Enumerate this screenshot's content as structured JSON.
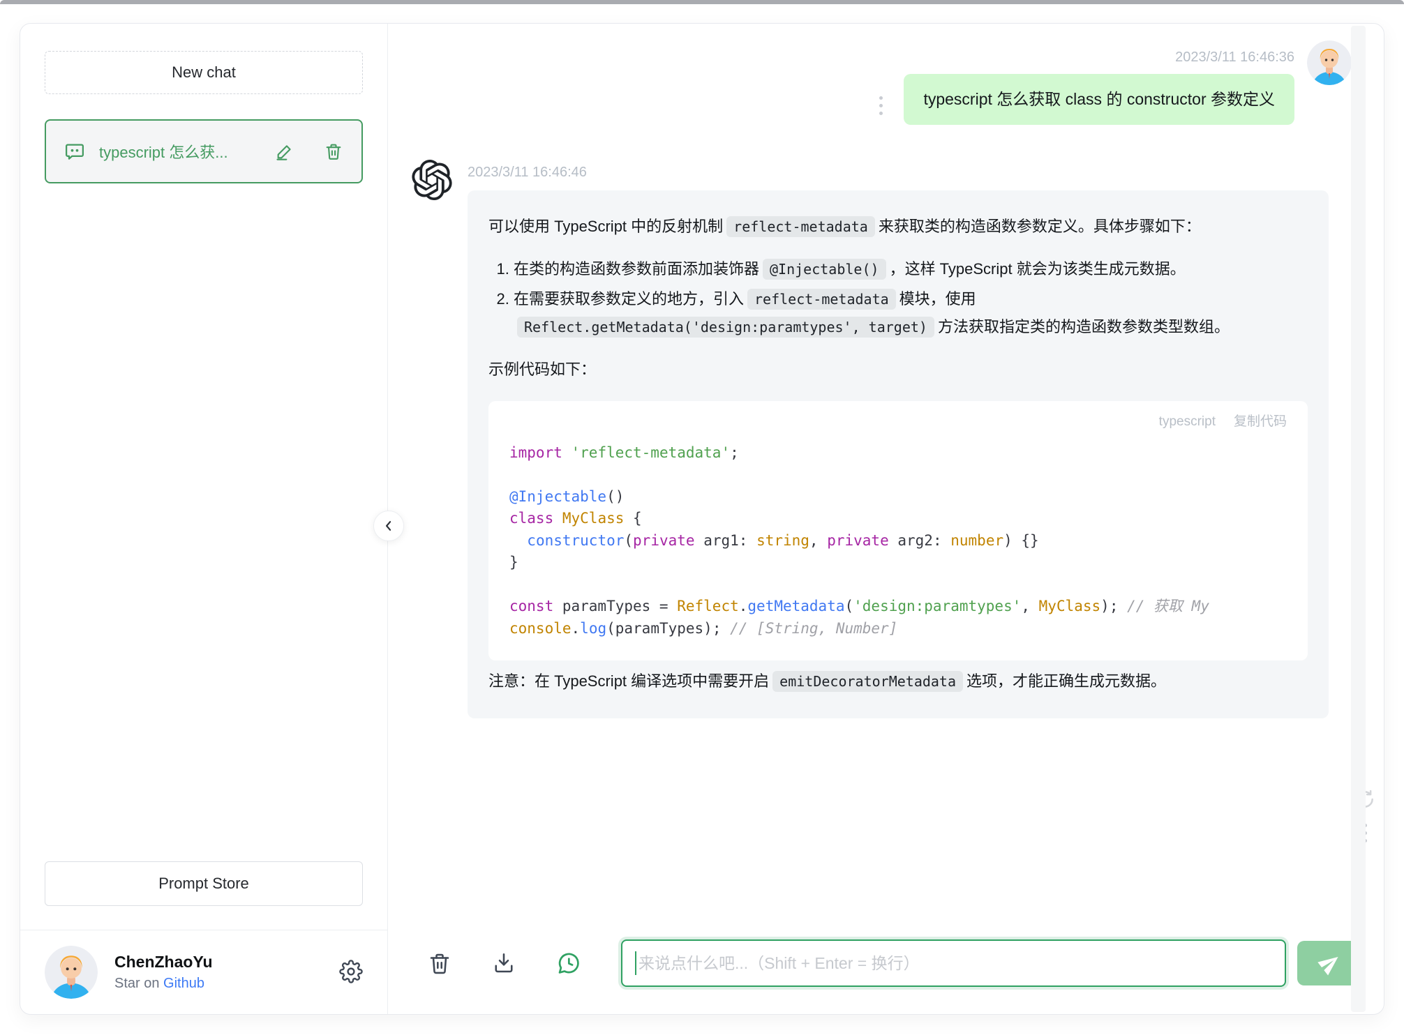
{
  "sidebar": {
    "new_chat_label": "New chat",
    "chat_item": {
      "title": "typescript 怎么获..."
    },
    "prompt_store_label": "Prompt Store",
    "user": {
      "name": "ChenZhaoYu",
      "star_prefix": "Star on ",
      "star_link": "Github"
    }
  },
  "chat": {
    "user_message": {
      "timestamp": "2023/3/11 16:46:36",
      "text": "typescript 怎么获取 class 的 constructor 参数定义"
    },
    "assistant_message": {
      "timestamp": "2023/3/11 16:46:46",
      "intro": [
        {
          "text": "可以使用 TypeScript 中的反射机制"
        },
        {
          "text": "reflect-metadata",
          "code": true
        },
        {
          "text": "来获取类的构造函数参数定义。具体步骤如下："
        }
      ],
      "steps": [
        [
          {
            "text": "在类的构造函数参数前面添加装饰器"
          },
          {
            "text": "@Injectable()",
            "code": true
          },
          {
            "text": "，这样 TypeScript 就会为该类生成元数据。"
          }
        ],
        [
          {
            "text": "在需要获取参数定义的地方，引入"
          },
          {
            "text": "reflect-metadata",
            "code": true
          },
          {
            "text": "模块，使用"
          },
          {
            "text": "Reflect.getMetadata('design:paramtypes', target)",
            "code": true
          },
          {
            "text": "方法获取指定类的构造函数参数类型数组。"
          }
        ]
      ],
      "example_label": "示例代码如下：",
      "code_block": {
        "language": "typescript",
        "copy_label": "复制代码",
        "lines": [
          [
            {
              "c": "kw",
              "t": "import"
            },
            {
              "c": "pl",
              "t": " "
            },
            {
              "c": "str",
              "t": "'reflect-metadata'"
            },
            {
              "c": "pl",
              "t": ";"
            }
          ],
          [],
          [
            {
              "c": "fn",
              "t": "@Injectable"
            },
            {
              "c": "pl",
              "t": "()"
            }
          ],
          [
            {
              "c": "kw",
              "t": "class"
            },
            {
              "c": "pl",
              "t": " "
            },
            {
              "c": "cls",
              "t": "MyClass"
            },
            {
              "c": "pl",
              "t": " {"
            }
          ],
          [
            {
              "c": "pl",
              "t": "  "
            },
            {
              "c": "fn",
              "t": "constructor"
            },
            {
              "c": "pl",
              "t": "("
            },
            {
              "c": "kw",
              "t": "private"
            },
            {
              "c": "pl",
              "t": " arg1: "
            },
            {
              "c": "cls",
              "t": "string"
            },
            {
              "c": "pl",
              "t": ", "
            },
            {
              "c": "kw",
              "t": "private"
            },
            {
              "c": "pl",
              "t": " arg2: "
            },
            {
              "c": "cls",
              "t": "number"
            },
            {
              "c": "pl",
              "t": ") {}"
            }
          ],
          [
            {
              "c": "pl",
              "t": "}"
            }
          ],
          [],
          [
            {
              "c": "kw",
              "t": "const"
            },
            {
              "c": "pl",
              "t": " paramTypes = "
            },
            {
              "c": "cls",
              "t": "Reflect"
            },
            {
              "c": "pl",
              "t": "."
            },
            {
              "c": "fn",
              "t": "getMetadata"
            },
            {
              "c": "pl",
              "t": "("
            },
            {
              "c": "str",
              "t": "'design:paramtypes'"
            },
            {
              "c": "pl",
              "t": ", "
            },
            {
              "c": "cls",
              "t": "MyClass"
            },
            {
              "c": "pl",
              "t": "); "
            },
            {
              "c": "cmt",
              "t": "// 获取 My"
            }
          ],
          [
            {
              "c": "cls",
              "t": "console"
            },
            {
              "c": "pl",
              "t": "."
            },
            {
              "c": "fn",
              "t": "log"
            },
            {
              "c": "pl",
              "t": "(paramTypes); "
            },
            {
              "c": "cmt",
              "t": "// [String, Number]"
            }
          ]
        ]
      },
      "note": [
        {
          "text": "注意：在 TypeScript 编译选项中需要开启"
        },
        {
          "text": "emitDecoratorMetadata",
          "code": true
        },
        {
          "text": "选项，才能正确生成元数据。"
        }
      ]
    }
  },
  "footer": {
    "input_placeholder": "来说点什么吧...（Shift + Enter = 换行）"
  },
  "colors": {
    "primary_green": "#2fa162",
    "sidebar_green": "#459b61",
    "user_bubble": "#d2f9d1",
    "assistant_bubble": "#f4f6f8",
    "send_button": "#8ecfa1",
    "link_blue": "#3d7af5",
    "timestamp_gray": "#b6bdc6"
  }
}
